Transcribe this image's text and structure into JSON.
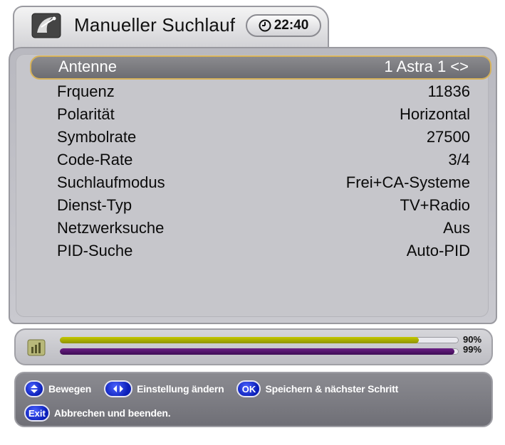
{
  "window": {
    "title": "Manueller Suchlauf",
    "clock": "22:40",
    "title_icon": "satellite-dish-icon",
    "clock_icon": "timer-icon"
  },
  "settings": [
    {
      "label": "Antenne",
      "value": "1 Astra 1 <>",
      "selected": true
    },
    {
      "label": "Frquenz",
      "value": "11836"
    },
    {
      "label": "Polarität",
      "value": "Horizontal"
    },
    {
      "label": "Symbolrate",
      "value": "27500"
    },
    {
      "label": "Code-Rate",
      "value": "3/4"
    },
    {
      "label": "Suchlaufmodus",
      "value": "Frei+CA-Systeme"
    },
    {
      "label": "Dienst-Typ",
      "value": "TV+Radio"
    },
    {
      "label": "Netzwerksuche",
      "value": "Aus"
    },
    {
      "label": "PID-Suche",
      "value": "Auto-PID"
    }
  ],
  "signal": {
    "strength_percent": 90,
    "strength_label": "90%",
    "quality_percent": 99,
    "quality_label": "99%",
    "strength_color": "#c4c800",
    "quality_color": "#6b1f85"
  },
  "help": {
    "move_label": "Bewegen",
    "change_label": "Einstellung ändern",
    "ok_key": "OK",
    "save_label": "Speichern & nächster Schritt",
    "exit_key": "Exit",
    "exit_label": "Abbrechen und beenden."
  },
  "colors": {
    "selection_border": "#d7b25a",
    "key_blue": "#0b1fb8"
  }
}
